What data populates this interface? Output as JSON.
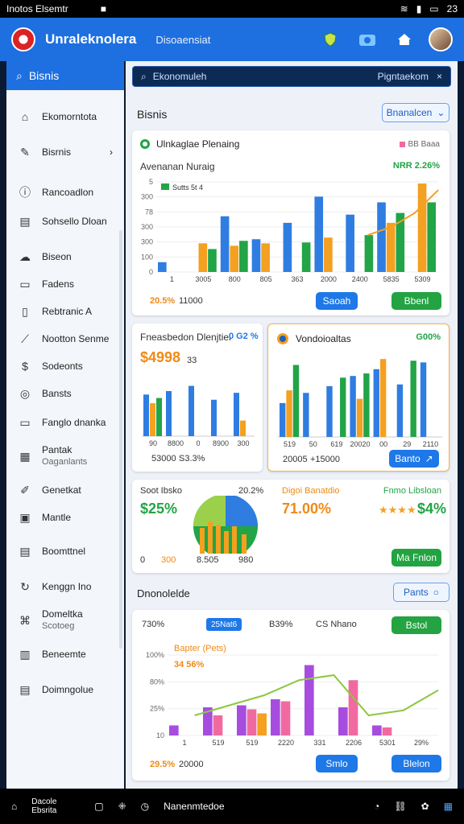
{
  "status": {
    "left_text": "Inotos Elsemtr",
    "time": "23"
  },
  "app": {
    "title": "Unraleknolera",
    "subtitle": "Disoaensiat"
  },
  "sidebar": {
    "search_label": "Bisnis",
    "items": [
      {
        "label": "Ekomorntota",
        "icon": "bank-icon"
      },
      {
        "label": "Bisrnis",
        "icon": "edit-icon",
        "chevron": "›"
      },
      {
        "label": "Rancoadlon",
        "icon": "info-icon"
      },
      {
        "label": "Sohsello Dloan",
        "icon": "folder-icon"
      },
      {
        "label": "Biseon",
        "icon": "cloud-icon"
      },
      {
        "label": "Fadens",
        "icon": "card-icon"
      },
      {
        "label": "Rebtranic A",
        "icon": "document-icon"
      },
      {
        "label": "Nootton Senme",
        "icon": "chart-icon"
      },
      {
        "label": "Sodeonts",
        "icon": "money-icon"
      },
      {
        "label": "Bansts",
        "icon": "spiral-icon"
      },
      {
        "label": "Fanglo dnanka",
        "icon": "monitor-icon"
      },
      {
        "label": "Pantak",
        "sub": "Oaganlants",
        "icon": "grid-icon"
      },
      {
        "label": "Genetkat",
        "icon": "pen-icon"
      },
      {
        "label": "Mantle",
        "icon": "image-icon"
      },
      {
        "label": "Boomttnel",
        "icon": "wallet-icon"
      },
      {
        "label": "Kenggn Ino",
        "icon": "refresh-icon"
      },
      {
        "label": "Domeltka",
        "sub": "Scotoeg",
        "icon": "network-icon"
      },
      {
        "label": "Beneemte",
        "icon": "building-icon"
      },
      {
        "label": "Doimngolue",
        "icon": "print-icon"
      }
    ]
  },
  "search": {
    "query": "Ekonomuleh",
    "scope": "Pigntaekom",
    "close": "×"
  },
  "sections": {
    "main_title": "Bisnis",
    "main_button": "Bnanalcen",
    "bottom_title": "Dnonolelde",
    "bottom_button": "Pants"
  },
  "card1": {
    "head": "Ulnkaglae Plenaing",
    "legend": "BB Baaa",
    "chart_title": "Avenanan Nuraig",
    "badge": "NRR 2.26%",
    "legend_inline": "Sutts 5t 4",
    "foot_left": "20.5%",
    "foot_right": "11000",
    "btn_blue": "Saoah",
    "btn_green": "Bbenl"
  },
  "card2": {
    "head": "Fneasbedon Dlenjtiel",
    "pct": "0 G2 %",
    "value": "$4998",
    "value_sub": "33",
    "foot": [
      "53000",
      "S3.3%"
    ]
  },
  "card3": {
    "head": "Vondoioaltas",
    "pct": "G00%",
    "foot": [
      "20005",
      "+15000"
    ],
    "btn": "Banto"
  },
  "card4": {
    "title_left": "Soot Ibsko",
    "pct_left": "20.2%",
    "value_left": "$25%",
    "title_mid": "Digoi Banatdio",
    "value_mid": "71.00%",
    "title_right": "Fnmo Libsloan",
    "stars": "★★★★",
    "value_right": "$4%",
    "axis": [
      "0",
      "300",
      "8.505",
      "980"
    ],
    "btn": "Ma Fnlon"
  },
  "card5": {
    "tab1": "730%",
    "tab2_chip": "25Nat6",
    "tab3": "B39%",
    "tab4": "CS Nhano",
    "btn": "Bstol",
    "legend_title": "Bapter (Pets)",
    "legend_val": "34 56%",
    "foot_left": "29.5%",
    "foot_right": "20000",
    "btn_blue1": "Smlo",
    "btn_blue2": "Blelon"
  },
  "bottom": {
    "left": "Dacole Ebsrita",
    "mid": "Nanenmtedoe"
  },
  "chart_data": [
    {
      "type": "bar",
      "title": "Avenanan Nuraig",
      "categories": [
        "1",
        "3005",
        "800",
        "805",
        "363",
        "2000",
        "2400",
        "5835",
        "5309"
      ],
      "yticks": [
        "0",
        "100",
        "300",
        "300",
        "78",
        "300",
        "5"
      ],
      "series": [
        {
          "color": "#2f7de1",
          "values": [
            12,
            0,
            68,
            40,
            60,
            92,
            70,
            85,
            0
          ]
        },
        {
          "color": "#f4a020",
          "values": [
            0,
            35,
            32,
            35,
            0,
            42,
            0,
            60,
            108
          ]
        },
        {
          "color": "#22a447",
          "values": [
            0,
            28,
            38,
            0,
            36,
            0,
            45,
            72,
            85
          ]
        }
      ],
      "trend": [
        45,
        55,
        72,
        100
      ]
    },
    {
      "type": "bar",
      "categories": [
        "90",
        "8800",
        "0",
        "8900",
        "300"
      ],
      "series": [
        {
          "color": "#2f7de1",
          "values": [
            48,
            52,
            58,
            42,
            50
          ]
        },
        {
          "color": "#f4a020",
          "values": [
            38,
            0,
            0,
            0,
            18
          ]
        },
        {
          "color": "#22a447",
          "values": [
            44,
            0,
            0,
            0,
            0
          ]
        }
      ]
    },
    {
      "type": "bar",
      "categories": [
        "519",
        "50",
        "619",
        "20020",
        "00",
        "29",
        "2110"
      ],
      "series": [
        {
          "color": "#2f7de1",
          "values": [
            40,
            52,
            60,
            72,
            80,
            62,
            88
          ]
        },
        {
          "color": "#f4a020",
          "values": [
            55,
            0,
            0,
            45,
            92,
            0,
            0
          ]
        },
        {
          "color": "#22a447",
          "values": [
            85,
            0,
            70,
            75,
            0,
            90,
            0
          ]
        }
      ]
    },
    {
      "type": "bar",
      "categories": [
        "1",
        "519",
        "519",
        "2220",
        "331",
        "2206",
        "5301",
        "29%"
      ],
      "yticks": [
        "10",
        "25%",
        "80%",
        "100%"
      ],
      "series": [
        {
          "color": "#a64de0",
          "values": [
            10,
            28,
            30,
            36,
            70,
            28,
            10,
            0
          ]
        },
        {
          "color": "#f06aa0",
          "values": [
            0,
            20,
            26,
            34,
            0,
            55,
            8,
            0
          ]
        },
        {
          "color": "#f4a020",
          "values": [
            0,
            0,
            22,
            0,
            0,
            0,
            0,
            0
          ]
        }
      ],
      "trend": [
        20,
        30,
        40,
        55,
        60,
        20,
        25,
        45
      ]
    }
  ]
}
